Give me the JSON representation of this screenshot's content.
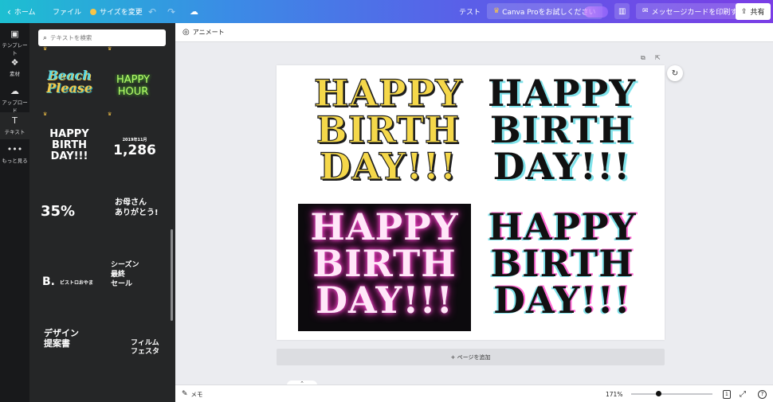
{
  "topbar": {
    "home": "ホーム",
    "file": "ファイル",
    "resize": "サイズを変更",
    "undo_icon": "undo-icon",
    "redo_icon": "redo-icon",
    "cloud_icon": "cloud-check-icon",
    "test": "テスト",
    "canva_pro": "Canva Proをお試しください",
    "message_card": "メッセージカードを印刷する",
    "share": "共有"
  },
  "rail": {
    "items": [
      {
        "icon": "template-icon",
        "label": "テンプレート"
      },
      {
        "icon": "elements-icon",
        "label": "素材"
      },
      {
        "icon": "upload-icon",
        "label": "アップロード"
      },
      {
        "icon": "text-icon",
        "label": "テキスト"
      },
      {
        "icon": "more-icon",
        "label": "もっと見る"
      }
    ]
  },
  "panel": {
    "search_placeholder": "テキストを検索",
    "templates": [
      {
        "line1": "Beach",
        "line2": "Please"
      },
      {
        "line1": "HAPPY",
        "line2": "HOUR"
      },
      {
        "line1": "HAPPY",
        "line2": "BIRTH",
        "line3": "DAY!!!"
      },
      {
        "line1": "2019年11月",
        "line2": "1,286"
      },
      {
        "line1": "35%"
      },
      {
        "line1": "お母さん",
        "line2": "ありがとう!"
      },
      {
        "line1": "B.",
        "line2": "ビストロおやま"
      },
      {
        "line1": "シーズン",
        "line2": "最終",
        "line3": "セール"
      },
      {
        "line1": "デザイン",
        "line2": "提案書"
      },
      {
        "line1": "フィルム",
        "line2": "フェスタ"
      }
    ]
  },
  "editor": {
    "animate": "アニメート",
    "add_page": "+ ページを追加",
    "designs": [
      {
        "l1": "HAPPY",
        "l2": "BIRTH",
        "l3": "DAY!!!"
      },
      {
        "l1": "HAPPY",
        "l2": "BIRTH",
        "l3": "DAY!!!"
      },
      {
        "l1": "HAPPY",
        "l2": "BIRTH",
        "l3": "DAY!!!"
      },
      {
        "l1": "HAPPY",
        "l2": "BIRTH",
        "l3": "DAY!!!"
      }
    ]
  },
  "bottombar": {
    "notes": "メモ",
    "zoom": "171%",
    "zoom_fraction": 0.33,
    "page_count": "1",
    "help": "?"
  },
  "colors": {
    "brand_gradient_start": "#1dbfd1",
    "brand_gradient_end": "#7a3ee6",
    "crown": "#f7c548",
    "neon_pink": "#ff2bc2"
  }
}
